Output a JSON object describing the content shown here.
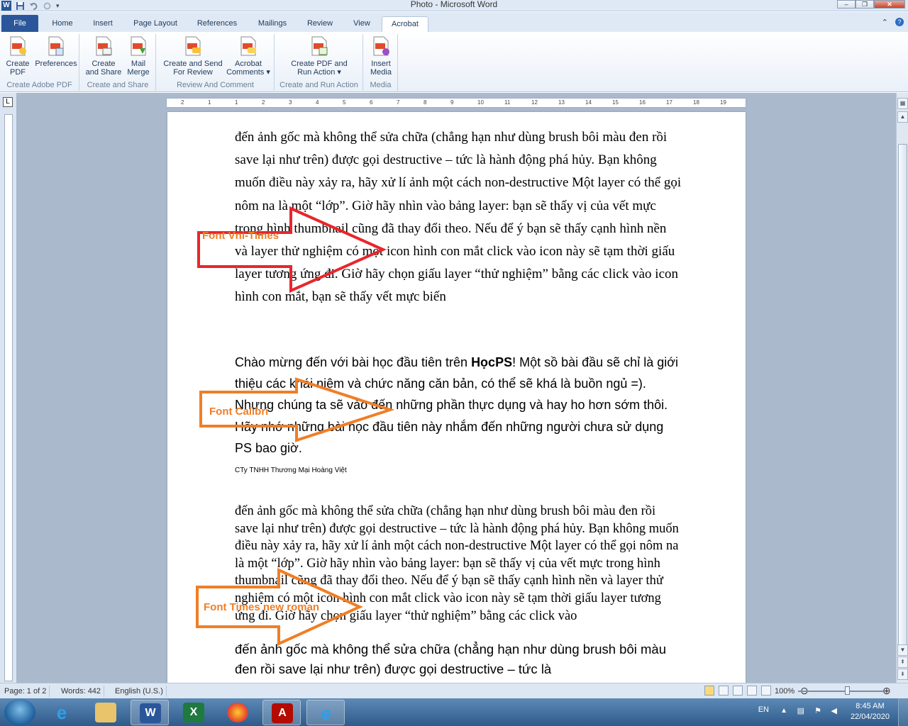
{
  "window": {
    "title": "Photo - Microsoft Word"
  },
  "tabs": [
    "File",
    "Home",
    "Insert",
    "Page Layout",
    "References",
    "Mailings",
    "Review",
    "View",
    "Acrobat"
  ],
  "ribbon": {
    "groups": [
      {
        "label": "Create Adobe PDF",
        "buttons": [
          "Create\nPDF",
          "Preferences"
        ]
      },
      {
        "label": "Create and Share",
        "buttons": [
          "Create\nand Share",
          "Mail\nMerge"
        ]
      },
      {
        "label": "Review And Comment",
        "buttons": [
          "Create and Send\nFor Review",
          "Acrobat\nComments ▾"
        ]
      },
      {
        "label": "Create and Run Action",
        "buttons": [
          "Create PDF and\nRun Action ▾"
        ]
      },
      {
        "label": "Media",
        "buttons": [
          "Insert\nMedia"
        ]
      }
    ]
  },
  "ruler": {
    "h_ticks": [
      "2",
      "1",
      "1",
      "2",
      "3",
      "4",
      "5",
      "6",
      "7",
      "8",
      "9",
      "10",
      "11",
      "12",
      "13",
      "14",
      "15",
      "16",
      "17",
      "18",
      "19"
    ]
  },
  "document": {
    "p1": "đến ảnh gốc mà không thể sửa chữa (chẳng hạn như dùng brush bôi màu đen rồi save lại như trên) được gọi destructive – tức là hành động phá hủy. Bạn không muốn điều này xảy ra, hãy xử lí ảnh một cách non-destructive Một layer có thể gọi nôm na là một “lớp”. Giờ hãy nhìn vào bảng layer: bạn sẽ thấy vị của vết mực trong hình thumbnail cũng đã thay đổi theo. Nếu để ý bạn sẽ thấy cạnh hình nền và layer thử nghiệm có một icon hình con mắt click vào icon này sẽ tạm thời giấu layer tương ứng đi. Giờ hãy chọn giấu layer “thử nghiệm” bằng các click vào icon hình con mắt, bạn sẽ thấy vết mực biến",
    "p2_before": " Chào mừng đến với bài học đầu tiên trên ",
    "p2_bold": "HọcPS",
    "p2_after": "! Một sồ bài đầu sẽ chỉ là giới thiệu các khái niệm và chức năng căn bản, có thể sẽ khá là buồn ngủ =). Nhưng chúng ta sẽ vào đến những phần thực dụng và hay ho hơn sớm thôi. Hãy nhớ những bài học đầu tiên này nhắm đến những người chưa sử dụng PS bao giờ.",
    "p3": "CTy TNHH Thương Mại Hoàng Việt",
    "p4": " đến ảnh gốc mà không thể sửa chữa (chẳng hạn như dùng brush bôi màu đen rồi save lại như trên) được gọi destructive – tức là hành động phá hủy. Bạn không muốn điều này xảy ra, hãy xử lí ảnh một cách non-destructive Một layer có thể gọi nôm na là một “lớp”. Giờ hãy nhìn vào bảng layer: bạn sẽ thấy vị của vết mực trong hình thumbnail cũng đã thay đổi theo. Nếu để ý bạn sẽ thấy cạnh hình nền và layer thử nghiệm có một icon hình con mắt click vào icon này sẽ tạm thời giấu layer tương ứng đi. Giờ hãy chọn giấu layer “thử nghiệm” bằng các click vào",
    "p5": " đến ảnh gốc mà không thể sửa chữa (chẳng hạn như dùng brush bôi màu đen rồi save lại như trên) được gọi destructive – tức là"
  },
  "annotations": {
    "arrow1": {
      "label": "Font Vni-Times",
      "color": "#e8262b"
    },
    "arrow2": {
      "label": "Font Calibri",
      "color": "#f07e26"
    },
    "arrow3": {
      "label": "Font Times new roman",
      "color": "#f07e26"
    }
  },
  "statusbar": {
    "page": "Page: 1 of 2",
    "words": "Words: 442",
    "language": "English (U.S.)",
    "zoom": "100%"
  },
  "taskbar": {
    "apps": [
      "internet-explorer",
      "file-explorer",
      "word",
      "excel",
      "firefox",
      "acrobat",
      "internet-explorer"
    ],
    "lang": "EN",
    "time": "8:45 AM",
    "date": "22/04/2020"
  }
}
